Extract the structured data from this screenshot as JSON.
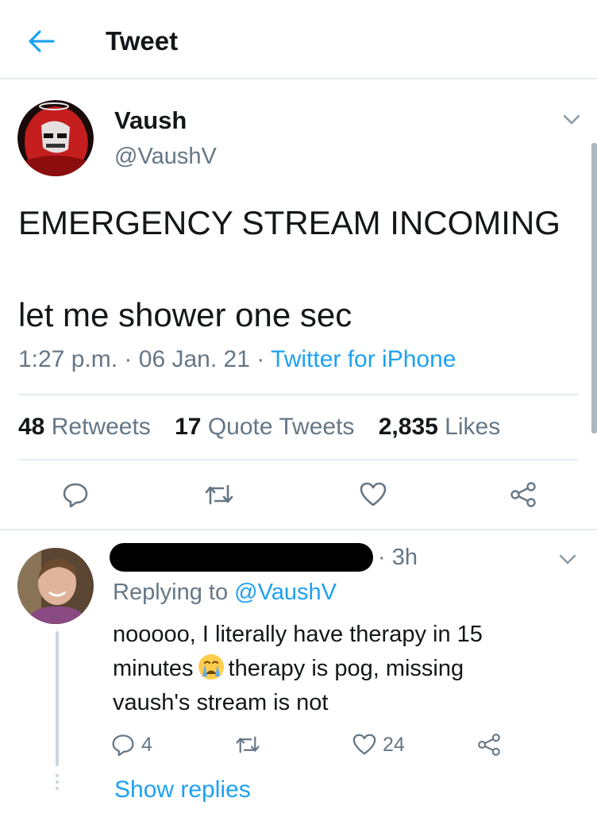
{
  "header": {
    "title": "Tweet",
    "back_icon": "arrow-left-icon"
  },
  "tweet": {
    "author_name": "Vaush",
    "author_handle": "@VaushV",
    "text": "EMERGENCY STREAM INCOMING\n\nlet me shower one sec",
    "time": "1:27 p.m.",
    "date": "06 Jan. 21",
    "source": "Twitter for iPhone",
    "sep": "·",
    "stats": {
      "retweets_count": "48",
      "retweets_label": "Retweets",
      "quotes_count": "17",
      "quotes_label": "Quote Tweets",
      "likes_count": "2,835",
      "likes_label": "Likes"
    }
  },
  "reply": {
    "time": "· 3h",
    "replying_prefix": "Replying to",
    "replying_handle": "@VaushV",
    "text_part1": "nooooo, I literally have therapy in 15 minutes",
    "text_part2": "therapy is pog, missing vaush's stream is not",
    "reply_count": "4",
    "like_count": "24",
    "show_replies": "Show replies"
  },
  "colors": {
    "accent": "#1da1f2",
    "secondary": "#657786",
    "divider": "#e6ecf0"
  }
}
